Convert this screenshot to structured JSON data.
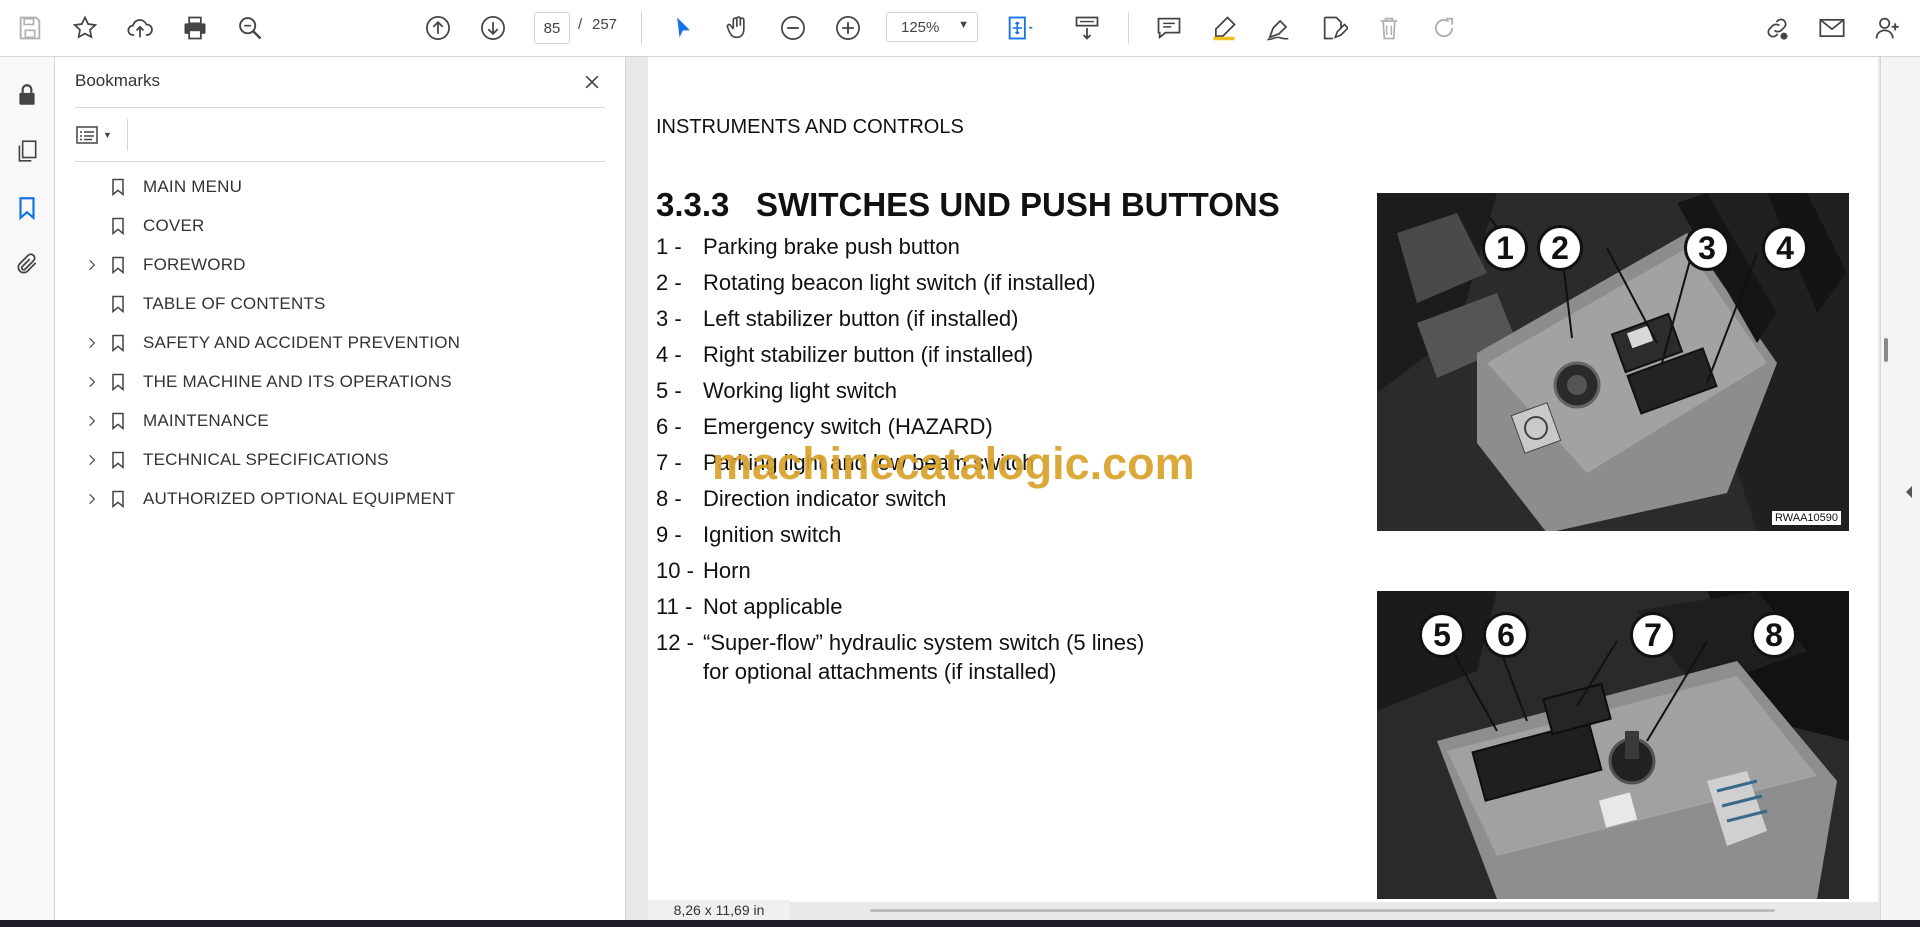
{
  "toolbar": {
    "current_page": "85",
    "page_separator": "/",
    "total_pages": "257",
    "zoom": "125%"
  },
  "bookmarks_panel": {
    "title": "Bookmarks",
    "items": [
      {
        "label": "MAIN MENU",
        "expandable": false
      },
      {
        "label": "COVER",
        "expandable": false
      },
      {
        "label": "FOREWORD",
        "expandable": true
      },
      {
        "label": "TABLE OF CONTENTS",
        "expandable": false
      },
      {
        "label": "SAFETY AND ACCIDENT PREVENTION",
        "expandable": true
      },
      {
        "label": "THE MACHINE AND ITS OPERATIONS",
        "expandable": true
      },
      {
        "label": "MAINTENANCE",
        "expandable": true
      },
      {
        "label": "TECHNICAL SPECIFICATIONS",
        "expandable": true
      },
      {
        "label": "AUTHORIZED OPTIONAL EQUIPMENT",
        "expandable": true
      }
    ]
  },
  "document": {
    "header": "INSTRUMENTS AND CONTROLS",
    "section_number": "3.3.3",
    "section_title": "SWITCHES UND PUSH BUTTONS",
    "items": [
      {
        "num": "1 -",
        "text": "Parking brake push button"
      },
      {
        "num": "2 -",
        "text": "Rotating beacon light switch (if installed)"
      },
      {
        "num": "3 -",
        "text": "Left stabilizer button (if installed)"
      },
      {
        "num": "4 -",
        "text": "Right stabilizer button (if installed)"
      },
      {
        "num": "5 -",
        "text": "Working light switch"
      },
      {
        "num": "6 -",
        "text": "Emergency switch (HAZARD)"
      },
      {
        "num": "7 -",
        "text": "Parking light and low beam switch"
      },
      {
        "num": "8 -",
        "text": "Direction indicator switch"
      },
      {
        "num": "9 -",
        "text": "Ignition switch"
      },
      {
        "num": "10 -",
        "text": "Horn"
      },
      {
        "num": "11 -",
        "text": "Not applicable"
      },
      {
        "num": "12 -",
        "text": "“Super-flow” hydraulic system switch (5 lines)",
        "text2": "for optional attachments (if installed)"
      }
    ],
    "watermark": "machinecatalogic.com",
    "photo1": {
      "code": "RWAA10590",
      "callouts": [
        "1",
        "2",
        "3",
        "4"
      ]
    },
    "photo2": {
      "callouts": [
        "5",
        "6",
        "7",
        "8"
      ]
    }
  },
  "status": {
    "page_size": "8,26 x 11,69 in"
  },
  "colors": {
    "accent": "#1473e6",
    "watermark": "#d9a22a"
  }
}
